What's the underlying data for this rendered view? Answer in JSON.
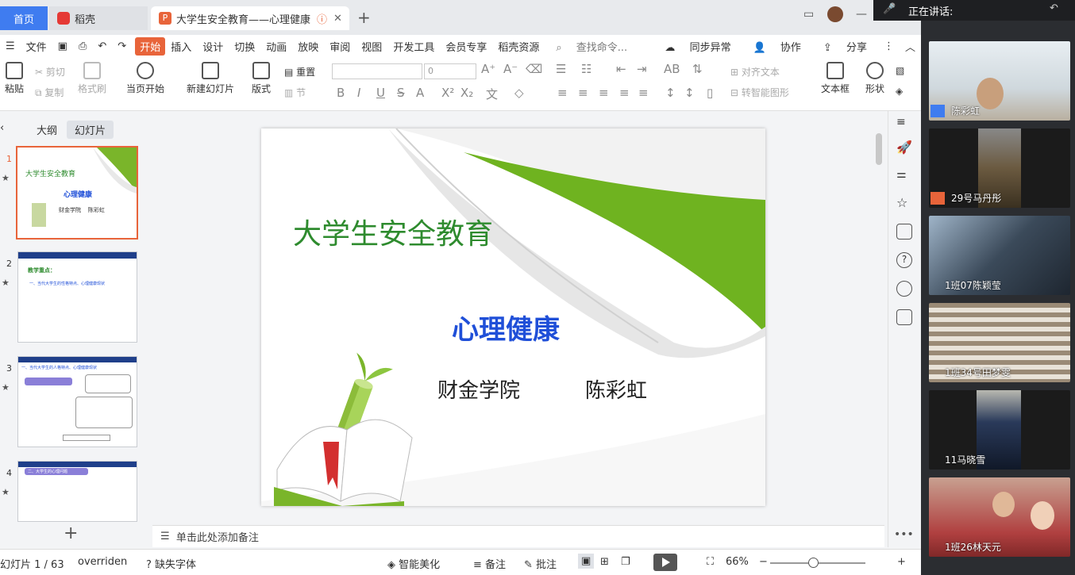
{
  "tabs": {
    "home": "首页",
    "daoke": "稻壳",
    "doc": "大学生安全教育——心理健康",
    "new_tab": "+"
  },
  "menu": {
    "file": "文件",
    "start": "开始",
    "items": [
      "插入",
      "设计",
      "切换",
      "动画",
      "放映",
      "审阅",
      "视图",
      "开发工具",
      "会员专享",
      "稻壳资源"
    ],
    "search": "查找命令...",
    "sync": "同步异常",
    "collab": "协作",
    "share": "分享"
  },
  "ribbon": {
    "paste": "粘贴",
    "cut": "剪切",
    "copy": "复制",
    "format_painter": "格式刷",
    "play_from_current": "当页开始",
    "new_slide": "新建幻灯片",
    "layout": "版式",
    "reset": "重置",
    "section": "节",
    "font_size": "0",
    "align_text": "对齐文本",
    "smart_shape": "转智能图形",
    "textbox": "文本框",
    "shape": "形状"
  },
  "left_panel": {
    "outline": "大纲",
    "slides": "幻灯片",
    "thumbs": [
      {
        "num": "1",
        "title": "大学生安全教育",
        "sub": "心理健康",
        "line": "财金学院    陈彩虹"
      },
      {
        "num": "2",
        "title": "教学重点：",
        "line": "一、当代大学生的性格特点、心理健康现状"
      },
      {
        "num": "3",
        "title": "一、当代大学生的人格特点、心理健康现状"
      },
      {
        "num": "4",
        "title": "二、大学生的心理问题"
      }
    ]
  },
  "slide": {
    "title": "大学生安全教育",
    "subtitle": "心理健康",
    "college": "财金学院",
    "author": "陈彩虹"
  },
  "notes": {
    "placeholder": "单击此处添加备注"
  },
  "status": {
    "slide_count": "幻灯片 1 / 63",
    "theme": "overriden",
    "missing_font": "缺失字体",
    "beautify": "智能美化",
    "notes": "备注",
    "comment": "批注",
    "zoom": "66%"
  },
  "meeting": {
    "speaking": "正在讲话:",
    "participants": [
      "陈彩虹",
      "29号马丹彤",
      "1班07陈颖莹",
      "1班34号田梦雯",
      "11马晓雪",
      "1班26林天元"
    ]
  }
}
